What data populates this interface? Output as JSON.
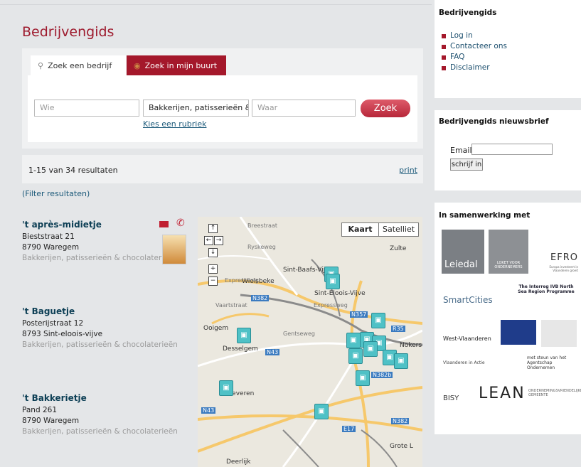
{
  "site": {
    "title": "Bedrijvengids"
  },
  "search": {
    "tab_company": "Zoek een bedrijf",
    "tab_nearby": "Zoek in mijn buurt",
    "wie_placeholder": "Wie",
    "category_value": "Bakkerijen, patisserieën & c",
    "waar_placeholder": "Waar",
    "zoek_label": "Zoek",
    "rubriek_link": "Kies een rubriek"
  },
  "results": {
    "count_text": "1-15 van 34 resultaten",
    "print_label": "print",
    "filter_label": "(Filter resultaten)"
  },
  "listings": [
    {
      "name": "'t après-midietje",
      "street": "Bieststraat 21",
      "city": "8790 Waregem",
      "category": "Bakkerijen, patisserieën & chocolaterieën"
    },
    {
      "name": "'t Baguetje",
      "street": "Posterijstraat 12",
      "city": "8793 Sint-eloois-vijve",
      "category": "Bakkerijen, patisserieën & chocolaterieën"
    },
    {
      "name": "'t Bakkerietje",
      "street": "Pand 261",
      "city": "8790 Waregem",
      "category": "Bakkerijen, patisserieën & chocolaterieën"
    }
  ],
  "map": {
    "type_map": "Kaart",
    "type_satellite": "Satelliet",
    "places": [
      "Zulte",
      "Sint-Baafs-Vijve",
      "Wielsbeke",
      "Sint-Eloois-Vijve",
      "Ooigem",
      "Desselgem",
      "Beveren",
      "Nokerse",
      "Grote L",
      "Expressweg",
      "Gentseweg",
      "Vaartstraat",
      "Ryskeweg",
      "Breestraat",
      "Expressweg",
      "Deerlijk"
    ],
    "roads": [
      "N357",
      "N382",
      "R35",
      "N43",
      "N43",
      "E17",
      "N382b",
      "N382"
    ]
  },
  "sidebar": {
    "heading": "Bedrijvengids",
    "menu": [
      "Log in",
      "Contacteer ons",
      "FAQ",
      "Disclaimer"
    ],
    "newsletter_heading": "Bedrijvengids nieuwsbrief",
    "email_label": "Email",
    "subscribe_label": "schrijf in",
    "partners_heading": "In samenwerking met",
    "partners": [
      "Leiedal",
      "LOKET VOOR ONDERNEMERS",
      "EFRO",
      "Europa investeert in Vlaanderen groeit",
      "SmartCities",
      "The Interreg IVB North Sea Region Programme",
      "West-Vlaanderen",
      "Vlaanderen in Actie",
      "met steun van het Agentschap Ondernemen",
      "BISY",
      "LEAN",
      "ONDERNEMINGSVRIENDELIJKE GEMEENTE"
    ]
  },
  "colors": {
    "brand": "#a4182b",
    "link": "#1c5a7a",
    "pin": "#4fc1c6"
  }
}
